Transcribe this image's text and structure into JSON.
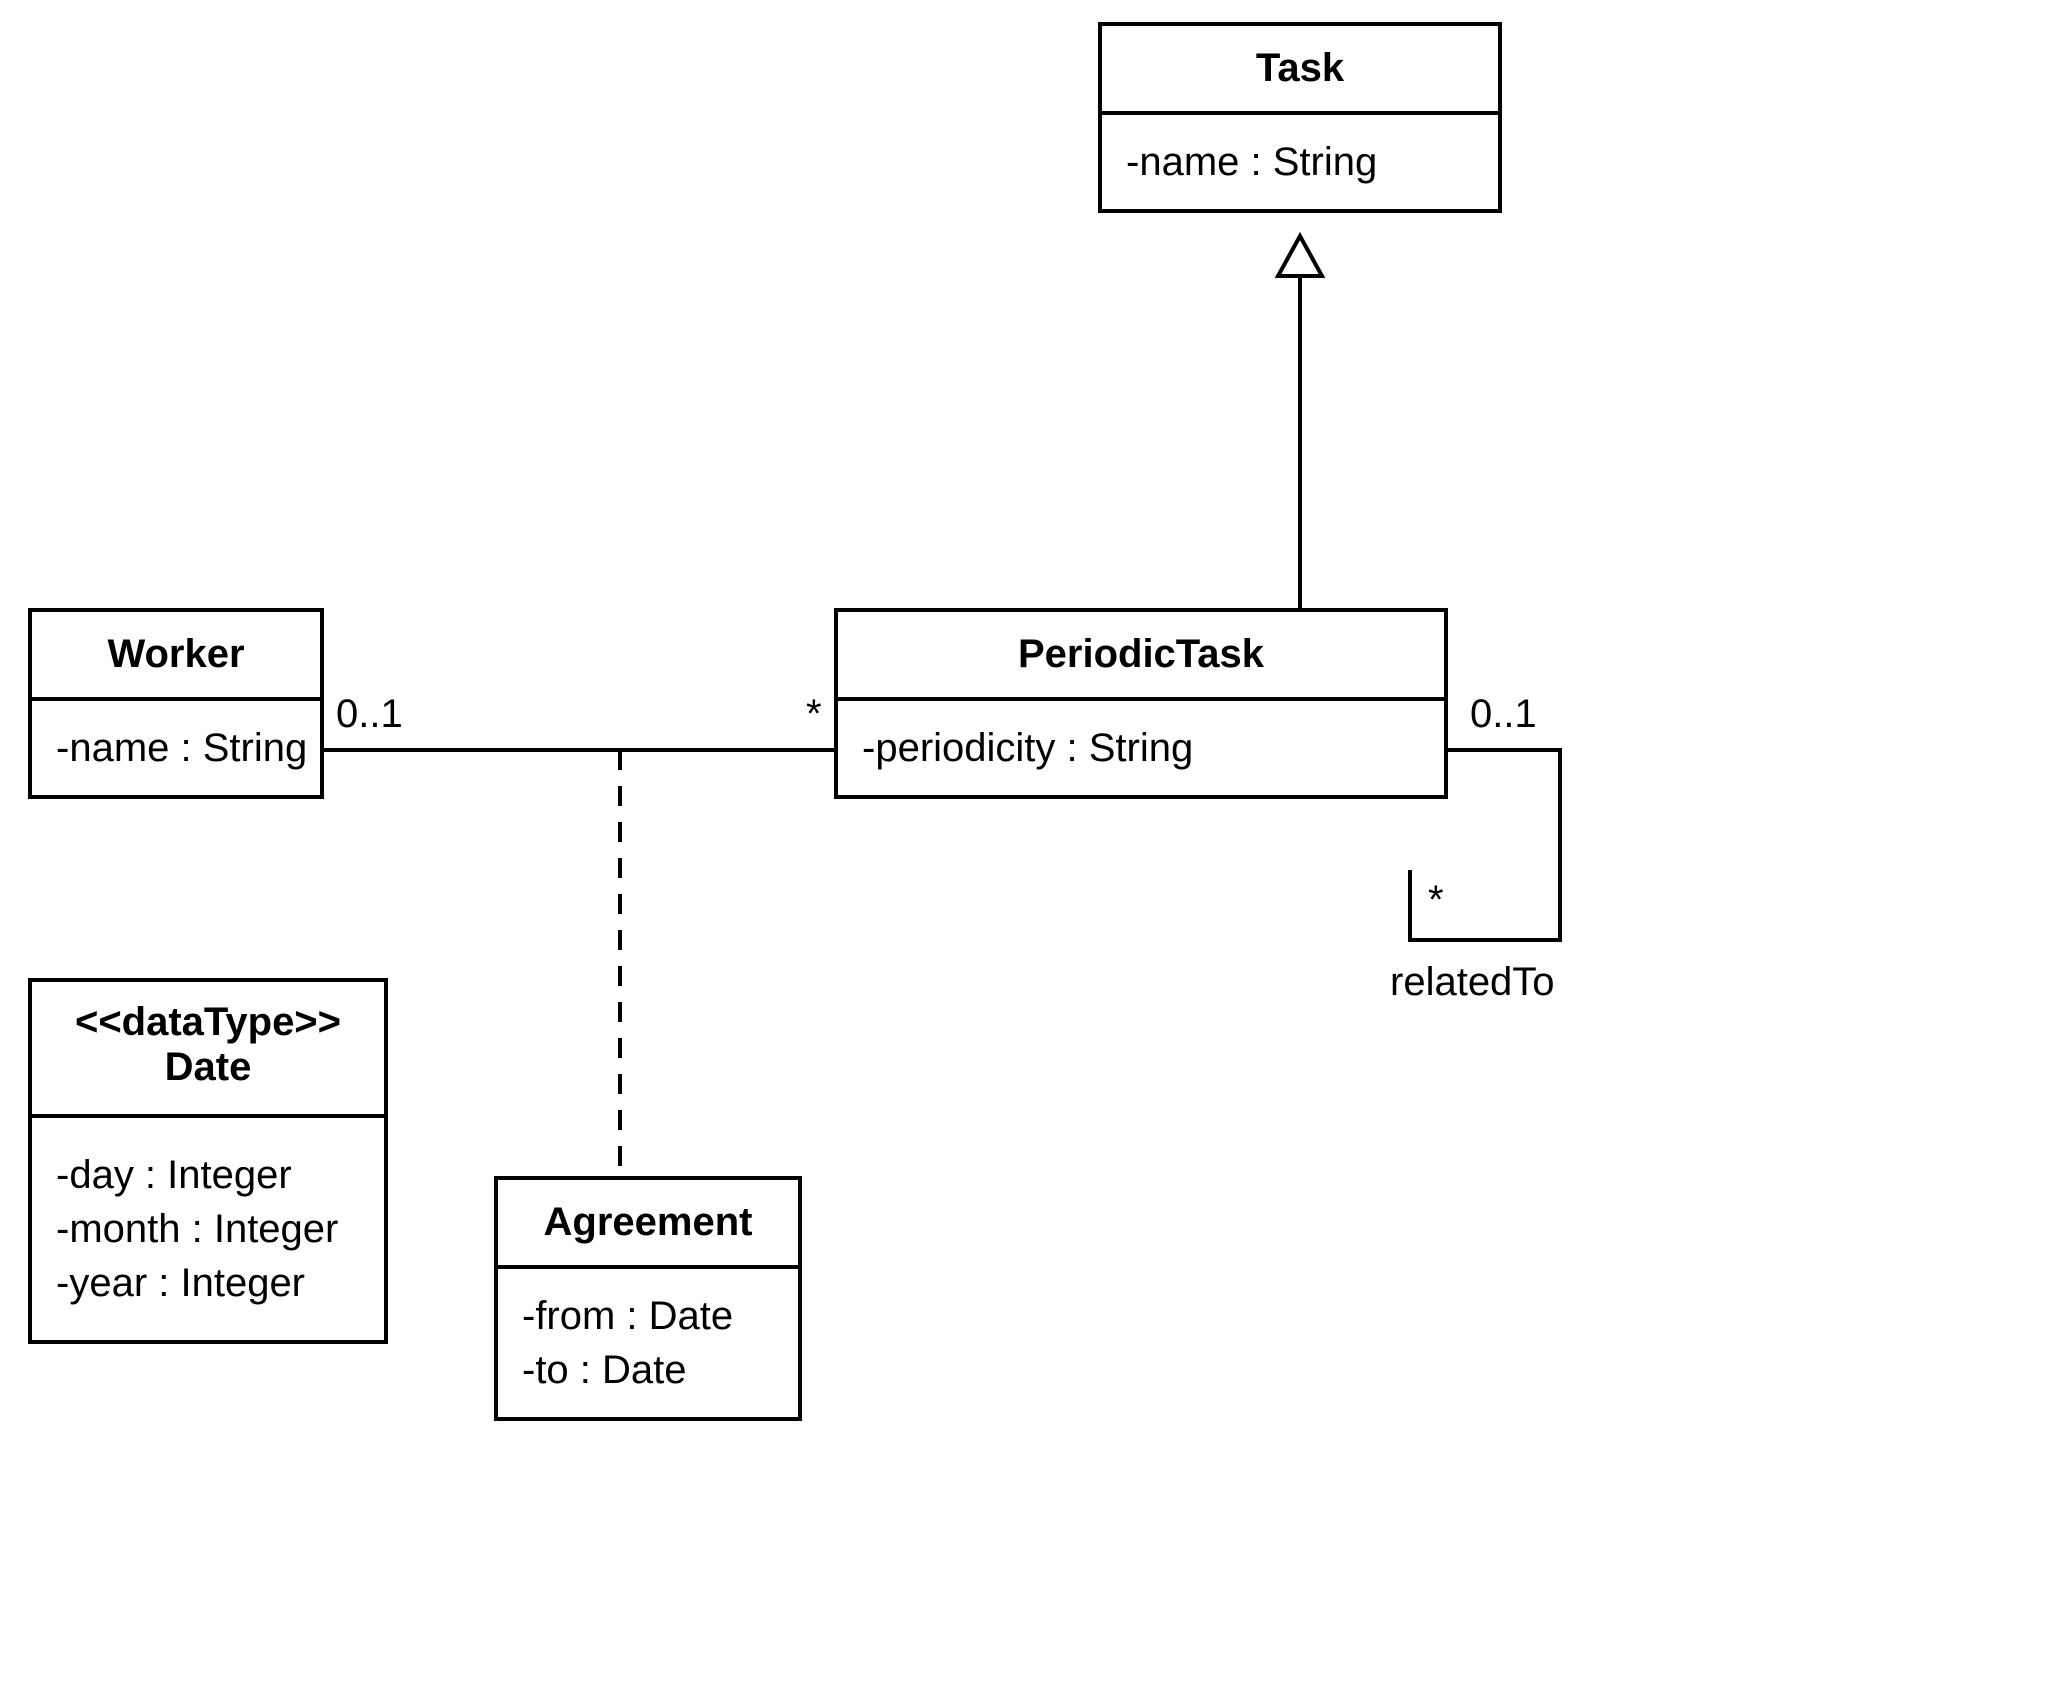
{
  "classes": {
    "task": {
      "name": "Task",
      "attrs": [
        "-name : String"
      ]
    },
    "worker": {
      "name": "Worker",
      "attrs": [
        "-name : String"
      ]
    },
    "periodicTask": {
      "name": "PeriodicTask",
      "attrs": [
        "-periodicity : String"
      ]
    },
    "date": {
      "stereotype": "<<dataType>>",
      "name": "Date",
      "attrs": [
        "-day : Integer",
        "-month : Integer",
        "-year : Integer"
      ]
    },
    "agreement": {
      "name": "Agreement",
      "attrs": [
        "-from : Date",
        "-to : Date"
      ]
    }
  },
  "multiplicities": {
    "workerSide": "0..1",
    "periodicTaskSide": "*",
    "selfTop": "0..1",
    "selfBottom": "*"
  },
  "labels": {
    "relatedTo": "relatedTo"
  }
}
